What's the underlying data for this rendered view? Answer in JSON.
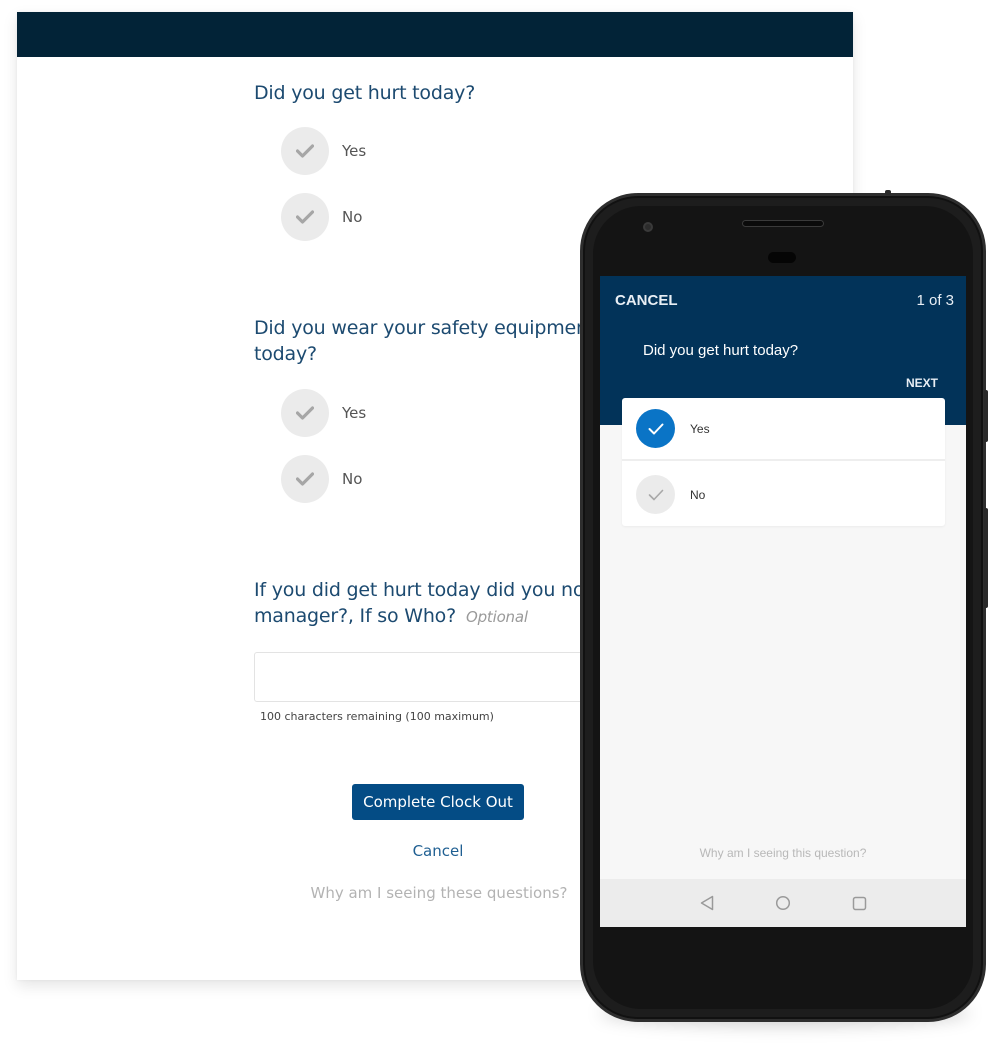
{
  "web": {
    "questions": [
      {
        "title": "Did you get hurt today?",
        "options": [
          "Yes",
          "No"
        ]
      },
      {
        "title_line1": "Did you wear your safety equipment",
        "title_line2": "today?",
        "options": [
          "Yes",
          "No"
        ]
      },
      {
        "title_line1": "If you did get hurt today did you not",
        "title_line2": "manager?, If so Who?",
        "optional_label": "Optional",
        "input_value": "",
        "char_count": "100 characters remaining (100 maximum)"
      }
    ],
    "complete_button": "Complete Clock Out",
    "cancel_link": "Cancel",
    "why_link": "Why am I seeing these questions?"
  },
  "mobile": {
    "cancel": "CANCEL",
    "progress": "1 of 3",
    "question": "Did you get hurt today?",
    "next": "NEXT",
    "options": [
      {
        "label": "Yes",
        "selected": true
      },
      {
        "label": "No",
        "selected": false
      }
    ],
    "why_link": "Why am I seeing this question?",
    "nav": [
      "back-icon",
      "home-icon",
      "recents-icon"
    ]
  },
  "colors": {
    "web_header": "#022337",
    "question_text": "#1c4a70",
    "primary_button": "#044c85",
    "app_header": "#023359",
    "selected_check": "#0a74c6"
  }
}
